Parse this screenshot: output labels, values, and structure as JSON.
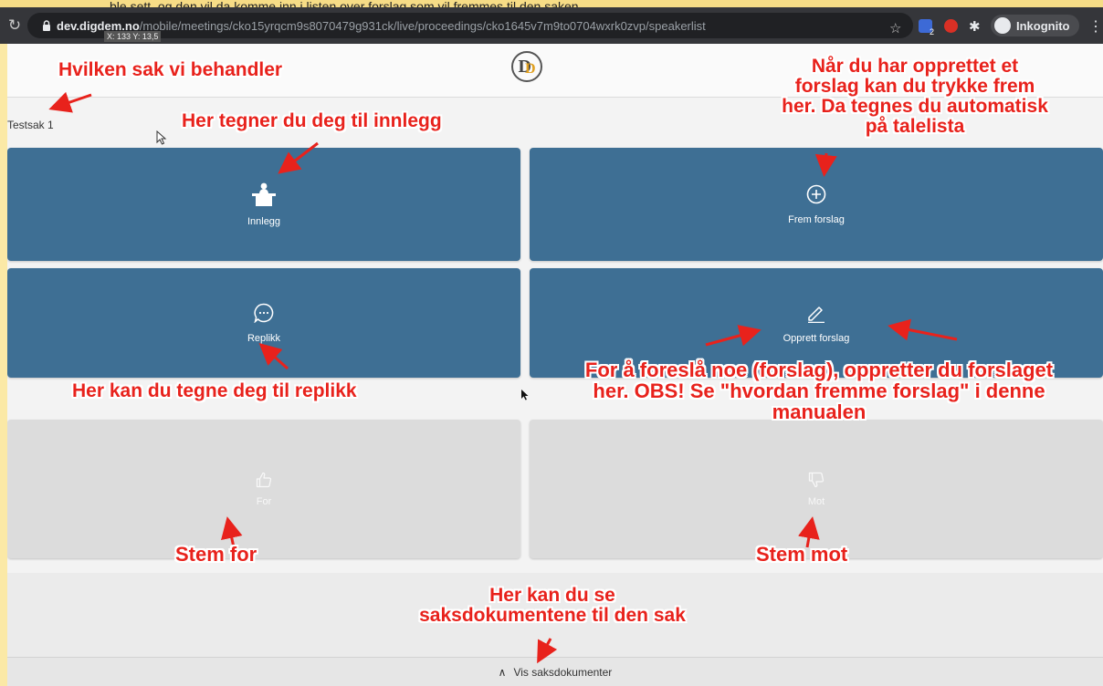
{
  "top_strip": {
    "text": "ble sett, og den vil da komme inn i listen over forslag som vil fremmes til den saken"
  },
  "browser": {
    "url_host": "dev.digdem.no",
    "url_path": "/mobile/meetings/cko15yrqcm9s8070479g931ck/live/proceedings/cko1645v7m9to0704wxrk0zvp/speakerlist",
    "coord_tooltip": "X: 133 Y: 13,5",
    "profile_label": "Inkognito",
    "ext_badge": "2"
  },
  "app": {
    "case_title": "Testsak 1",
    "tiles": {
      "innlegg": "Innlegg",
      "frem_forslag": "Frem forslag",
      "replikk": "Replikk",
      "opprett_forslag": "Opprett forslag",
      "for": "For",
      "mot": "Mot"
    },
    "docs_toggle": "Vis saksdokumenter",
    "colors": {
      "tile_active": "#3e6f94",
      "tile_disabled": "#dcdcdc",
      "annotation": "#e8221c"
    }
  },
  "annotations": {
    "current_case": "Hvilken sak vi behandler",
    "innlegg": "Her tegner du deg til innlegg",
    "frem_forslag": [
      "Når du har opprettet et",
      "forslag kan du trykke frem",
      "her. Da tegnes du automatisk",
      "på talelista"
    ],
    "replikk": "Her kan du tegne deg til replikk",
    "opprett": [
      "For å foreslå noe (forslag), oppretter du forslaget",
      "her. OBS! Se \"hvordan fremme forslag\" i denne",
      "manualen"
    ],
    "stem_for": "Stem for",
    "stem_mot": "Stem mot",
    "docs": [
      "Her kan du se",
      "saksdokumentene til den sak"
    ]
  }
}
